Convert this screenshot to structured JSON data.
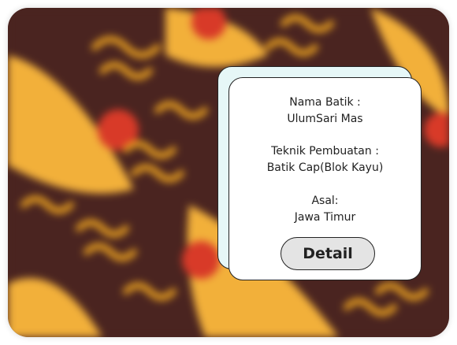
{
  "card": {
    "name_label": "Nama Batik :",
    "name_value": "UlumSari Mas",
    "technique_label": "Teknik Pembuatan :",
    "technique_value": "Batik Cap(Blok Kayu)",
    "origin_label": "Asal:",
    "origin_value": "Jawa Timur",
    "detail_button": "Detail"
  },
  "colors": {
    "background_brown": "#4a2420",
    "motif_yellow": "#f0a820",
    "motif_red": "#d83a28",
    "card_back": "#e6f7f7",
    "button_gray": "#e4e4e4"
  }
}
